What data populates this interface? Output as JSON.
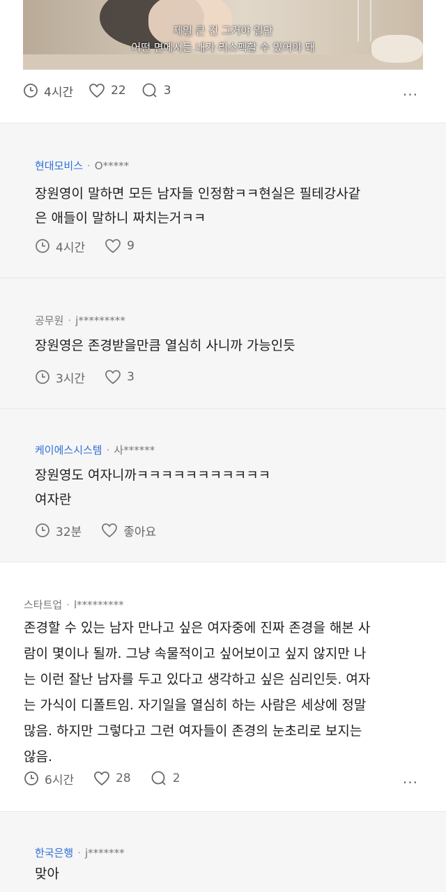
{
  "post": {
    "subtitle_line1": "제일 큰 건 그거야 일단",
    "subtitle_line2": "어떤 면에서든 내가 리스펙할 수 있어야 돼",
    "time": "4시간",
    "likes": "22",
    "comments": "3",
    "more": "..."
  },
  "comments": [
    {
      "company": "현대모비스",
      "user": "O*****",
      "text_lines": [
        "장원영이 말하면 모든 남자들 인정함ㅋㅋ현실은 필테강사같",
        "은 애들이 말하니 짜치는거ㅋㅋ"
      ],
      "time": "4시간",
      "likes": "9"
    },
    {
      "company": "공무원",
      "user": "j*********",
      "text_lines": [
        "장원영은 존경받을만큼 열심히 사니까 가능인듯"
      ],
      "time": "3시간",
      "likes": "3"
    },
    {
      "company": "케이에스시스템",
      "user": "사******",
      "text_lines": [
        "장원영도 여자니까ㅋㅋㅋㅋㅋㅋㅋㅋㅋㅋㅋ",
        "여자란"
      ],
      "time": "32분",
      "likes": "좋아요"
    },
    {
      "company": "스타트업",
      "user": "l*********",
      "text_lines": [
        "존경할 수 있는 남자 만나고 싶은 여자중에 진짜 존경을 해본 사",
        "람이 몇이나 될까. 그냥 속물적이고 싶어보이고 싶지 않지만 나",
        "는 이런 잘난 남자를 두고 있다고 생각하고 싶은 심리인듯. 여자",
        "는 가식이 디폴트임. 자기일을 열심히 하는 사람은 세상에 정말",
        "많음. 하지만 그렇다고 그런 여자들이 존경의 눈초리로 보지는",
        "않음."
      ],
      "time": "6시간",
      "likes": "28",
      "comments": "2",
      "more": "..."
    },
    {
      "company": "한국은행",
      "user": "j*******",
      "text_lines": [
        "맞아"
      ]
    }
  ],
  "icons": {
    "clock": "clock-icon",
    "heart": "heart-icon",
    "comment": "comment-bubble-icon",
    "more": "more-dots-icon"
  },
  "colors": {
    "company_link": "#2f6fd6",
    "comment_bg": "#f6f6f7"
  }
}
